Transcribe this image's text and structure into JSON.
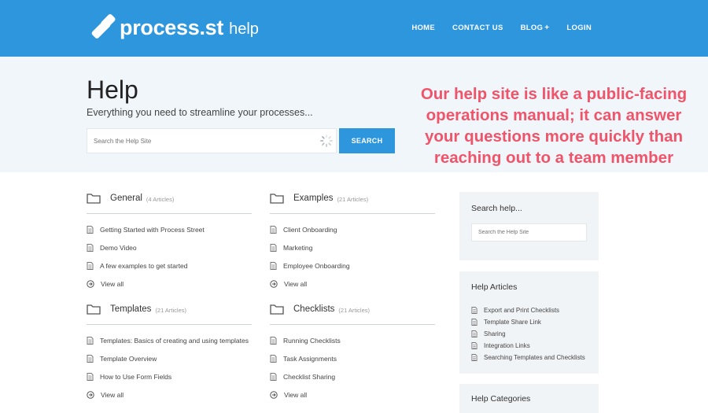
{
  "header": {
    "brand": "process.st",
    "brand_suffix": "help",
    "nav": [
      {
        "label": "HOME"
      },
      {
        "label": "CONTACT US"
      },
      {
        "label": "BLOG",
        "suffix": "+"
      },
      {
        "label": "LOGIN"
      }
    ]
  },
  "hero": {
    "title": "Help",
    "subtitle": "Everything you need to streamline your processes...",
    "search_placeholder": "Search the Help Site",
    "search_button": "SEARCH"
  },
  "callout": "Our help site is like a public-facing operations manual; it can answer your questions more quickly than reaching out to a team member",
  "categories": [
    {
      "title": "General",
      "count": "(4 Articles)",
      "articles": [
        "Getting Started with Process Street",
        "Demo Video",
        "A few examples to get started"
      ],
      "view_all": "View all"
    },
    {
      "title": "Examples",
      "count": "(21 Articles)",
      "articles": [
        "Client Onboarding",
        "Marketing",
        "Employee Onboarding"
      ],
      "view_all": "View all"
    },
    {
      "title": "Templates",
      "count": "(21 Articles)",
      "articles": [
        "Templates: Basics of creating and using templates",
        "Template Overview",
        "How to Use Form Fields"
      ],
      "view_all": "View all"
    },
    {
      "title": "Checklists",
      "count": "(21 Articles)",
      "articles": [
        "Running Checklists",
        "Task Assignments",
        "Checklist Sharing"
      ],
      "view_all": "View all"
    }
  ],
  "sidebar": {
    "search": {
      "title": "Search help...",
      "placeholder": "Search the Help Site"
    },
    "articles": {
      "title": "Help Articles",
      "items": [
        "Export and Print Checklists",
        "Template Share Link",
        "Sharing",
        "Integration Links",
        "Searching Templates and Checklists"
      ]
    },
    "categories": {
      "title": "Help Categories"
    }
  },
  "colors": {
    "brand_blue": "#2d96dd",
    "callout_pink": "#f0546a",
    "hero_bg": "#f1f6fa"
  }
}
